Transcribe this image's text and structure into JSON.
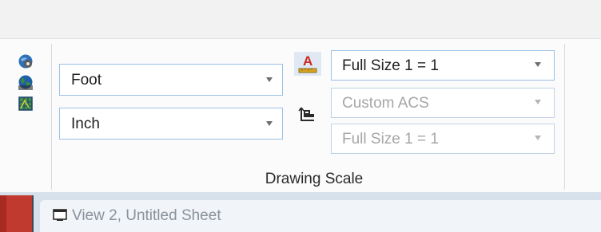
{
  "drawing_scale_group": {
    "label": "Drawing Scale",
    "left_icons": [
      "settings-globe-icon",
      "globe-earth-icon",
      "map-grid-icon"
    ],
    "master_unit": {
      "value": "Foot"
    },
    "sub_unit": {
      "value": "Inch"
    },
    "annotation_scale_icon": "annotation-scale-icon",
    "acs_icon": "acs-icon",
    "annotation_scale": {
      "value": "Full Size 1 = 1",
      "enabled": true
    },
    "acs": {
      "value": "Custom ACS",
      "enabled": false
    },
    "acs_scale": {
      "value": "Full Size 1 = 1",
      "enabled": false
    }
  },
  "view": {
    "title": "View 2, Untitled Sheet",
    "icon": "view-window-icon"
  },
  "colors": {
    "field_border": "#9cc0e4",
    "annotation_red": "#cc2a22",
    "disabled_text": "#a6a6a6"
  }
}
